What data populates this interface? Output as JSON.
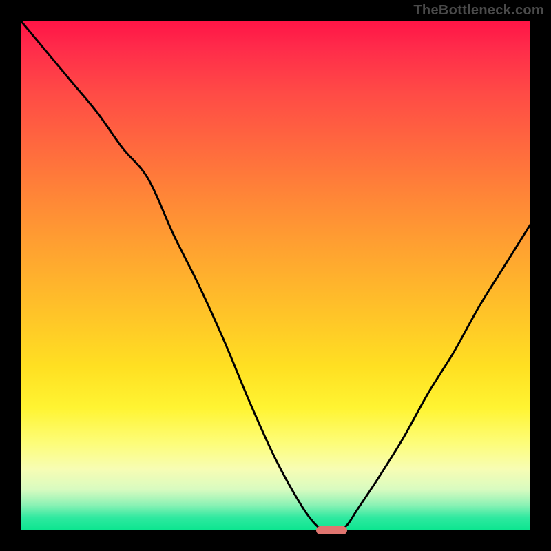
{
  "watermark": "TheBottleneck.com",
  "colors": {
    "frame": "#000000",
    "curve": "#000000",
    "marker": "#e0756f",
    "watermark_text": "#4a4a4a"
  },
  "chart_data": {
    "type": "line",
    "title": "",
    "xlabel": "",
    "ylabel": "",
    "xlim": [
      0,
      100
    ],
    "ylim": [
      0,
      100
    ],
    "series": [
      {
        "name": "bottleneck-curve",
        "x": [
          0,
          5,
          10,
          15,
          20,
          25,
          30,
          35,
          40,
          45,
          50,
          55,
          58,
          60,
          62,
          64,
          66,
          70,
          75,
          80,
          85,
          90,
          95,
          100
        ],
        "y": [
          100,
          94,
          88,
          82,
          75,
          69,
          58,
          48,
          37,
          25,
          14,
          5,
          1,
          0,
          0,
          1,
          4,
          10,
          18,
          27,
          35,
          44,
          52,
          60
        ]
      }
    ],
    "marker": {
      "x_start": 58,
      "x_end": 64,
      "y": 0
    },
    "background_gradient": {
      "stops": [
        {
          "pos": 0,
          "color": "#ff1446"
        },
        {
          "pos": 25,
          "color": "#ff6a3e"
        },
        {
          "pos": 50,
          "color": "#ffb82a"
        },
        {
          "pos": 75,
          "color": "#fff432"
        },
        {
          "pos": 90,
          "color": "#e8fcbe"
        },
        {
          "pos": 100,
          "color": "#0be58f"
        }
      ]
    }
  }
}
